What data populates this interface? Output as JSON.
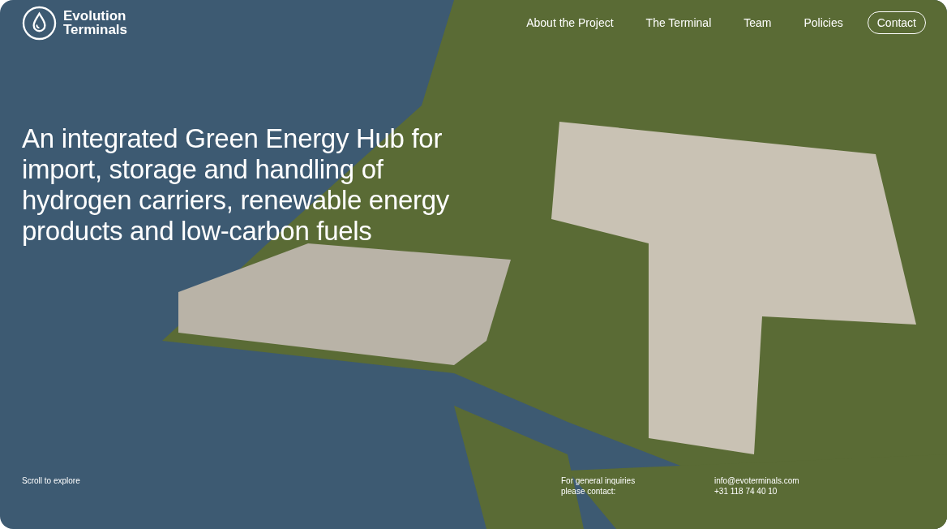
{
  "logo": {
    "line1": "Evolution",
    "line2": "Terminals"
  },
  "nav": [
    {
      "label": "About the Project",
      "kind": "link"
    },
    {
      "label": "The Terminal",
      "kind": "link"
    },
    {
      "label": "Team",
      "kind": "link"
    },
    {
      "label": "Policies",
      "kind": "link"
    },
    {
      "label": "Contact",
      "kind": "button"
    }
  ],
  "headline": "An integrated Green Energy Hub for import, storage and handling of hydrogen carriers, renewable energy products and low-carbon fuels",
  "footer": {
    "scroll_hint": "Scroll to explore",
    "inquiries": [
      "For general inquiries",
      "please contact:"
    ],
    "email": "info@evoterminals.com",
    "phone": "+31 118 74 40 10"
  }
}
